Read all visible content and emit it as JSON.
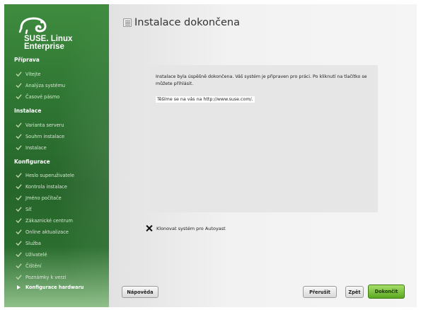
{
  "window": {
    "title": "Instalace dokončena"
  },
  "sidebar": {
    "brand_line1": "SUSE. Linux",
    "brand_line2": "Enterprise",
    "sections": [
      {
        "label": "Příprava",
        "items": [
          "Vítejte",
          "Analýza systému",
          "Časové pásmo"
        ]
      },
      {
        "label": "Instalace",
        "items": [
          "Varianta serveru",
          "Souhrn instalace",
          "Instalace"
        ]
      },
      {
        "label": "Konfigurace",
        "items": [
          "Heslo superuživatele",
          "Kontrola instalace",
          "Jméno počítače",
          "Síť",
          "Zákaznické centrum",
          "Online aktualizace",
          "Služba",
          "Uživatelé",
          "Čištění",
          "Poznámky k verzi",
          "Konfigurace hardwaru"
        ]
      }
    ],
    "current_item": "Konfigurace hardwaru"
  },
  "main": {
    "message_p1": "Instalace byla úspěšně dokončena. Váš systém je připraven pro práci. Po kliknutí na tlačítko se můžete přihlásit.",
    "message_p2": "Těšíme se na vás na http://www.suse.com/.",
    "clone_label": "Klonovat systém pro Autoyast",
    "clone_checked": true
  },
  "buttons": {
    "help": "Nápověda",
    "abort": "Přerušit",
    "back": "Zpět",
    "finish": "Dokončit"
  },
  "colors": {
    "sidebar_green": "#2f7633",
    "finish_button": "#5aa81f"
  }
}
